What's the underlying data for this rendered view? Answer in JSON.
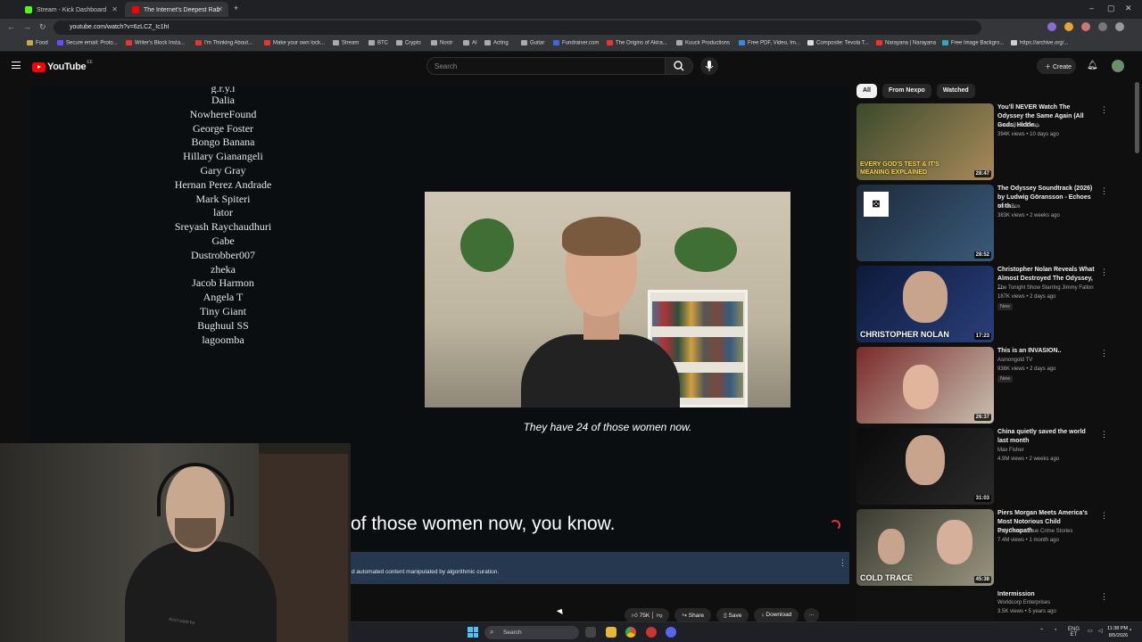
{
  "browser": {
    "tabs": [
      {
        "title": "Stream - Kick Dashboard",
        "color": "#53fc18"
      },
      {
        "title": "The Internet's Deepest Rab",
        "color": "#ff0000"
      }
    ],
    "url": "youtube.com/watch?v=6zLCZ_Ic1hI",
    "bookmarks": [
      "Food",
      "Secure email: Proto...",
      "Writer's Block Insta...",
      "I'm Thinking About...",
      "Make your own lock...",
      "Stream",
      "BTC",
      "Crypto",
      "Nostr",
      "AI",
      "Acting",
      "Guitar",
      "Fundraiser.com",
      "The Origins of Akira...",
      "Kuuck Productions",
      "Free PDF, Video, Im...",
      "Composite: Tevola T...",
      "Narayana | Narayana",
      "Free Image Backgro...",
      "https://archive.org/..."
    ]
  },
  "youtube": {
    "logo_text": "YouTube",
    "logo_cc": "EE",
    "search_placeholder": "Search",
    "create_label": "Create"
  },
  "player": {
    "credits": [
      "g.r.y.l",
      "Dalia",
      "NowhereFound",
      "George Foster",
      "Bongo Banana",
      "Hillary Gianangeli",
      "Gary Gray",
      "Hernan Perez Andrade",
      "Mark Spiteri",
      "lator",
      "Sreyash Raychaudhuri",
      "Gabe",
      "Dustrobber007",
      "zheka",
      "Jacob Harmon",
      "Angela T",
      "Tiny Giant",
      "Bughuul SS",
      "lagoomba"
    ],
    "subtitle_small": "They have 24 of those women now.",
    "caption_big": "of those women now, you know."
  },
  "notice": {
    "text": "d automated content manipulated by algorithmic curation."
  },
  "actions": {
    "likes": "75K",
    "share": "Share",
    "save": "Save",
    "download": "Download"
  },
  "chips": [
    {
      "label": "All",
      "active": true
    },
    {
      "label": "From Nexpo",
      "active": false
    },
    {
      "label": "Watched",
      "active": false
    }
  ],
  "recommendations": [
    {
      "title": "You'll NEVER Watch The Odyssey the Same Again (All Gods, Hidde...",
      "channel": "Movie Balls Deep",
      "meta": "394K views • 10 days ago",
      "duration": "28:47",
      "thumb_text": "EVERY GOD'S TEST & IT'S MEANING EXPLAINED",
      "badge": "",
      "colors": [
        "#3b4a2c",
        "#a98a5a"
      ]
    },
    {
      "title": "The Odyssey Soundtrack (2026) by Ludwig Göransson - Echoes of th...",
      "channel": "Kaka Box",
      "meta": "383K views • 2 weeks ago",
      "duration": "28:52",
      "thumb_text": "",
      "badge": "",
      "colors": [
        "#1d2a3a",
        "#3a5a7a"
      ]
    },
    {
      "title": "Christopher Nolan Reveals What Almost Destroyed The Odyssey, ...",
      "channel": "The Tonight Show Starring Jimmy Fallon",
      "meta": "187K views • 2 days ago",
      "duration": "17:23",
      "thumb_text": "CHRISTOPHER NOLAN",
      "badge": "New",
      "colors": [
        "#0d1a3a",
        "#2a3f7a"
      ]
    },
    {
      "title": "This is an INVASION..",
      "channel": "Asmongold TV",
      "meta": "936K views • 2 days ago",
      "duration": "26:37",
      "thumb_text": "",
      "badge": "New",
      "colors": [
        "#7a2a2a",
        "#c9c0b0"
      ]
    },
    {
      "title": "China quietly saved the world last month",
      "channel": "Max Fisher",
      "meta": "4.9M views • 2 weeks ago",
      "duration": "31:03",
      "thumb_text": "",
      "badge": "",
      "colors": [
        "#0a0a0a",
        "#2a2a2a"
      ]
    },
    {
      "title": "Piers Morgan Meets America's Most Notorious Child Psychopath",
      "channel": "Cold Trace - True Crime Stories",
      "meta": "7.4M views • 1 month ago",
      "duration": "45:38",
      "thumb_text": "COLD TRACE",
      "badge": "",
      "colors": [
        "#3a3a30",
        "#9a9580"
      ]
    },
    {
      "title": "Intermission",
      "channel": "Worldcorp Enterprises",
      "meta": "3.5K views • 5 years ago",
      "duration": "",
      "thumb_text": "",
      "badge": "",
      "colors": [
        "#111",
        "#222"
      ]
    }
  ],
  "webcam": {
    "shirt_text": "don't work for"
  },
  "taskbar": {
    "search_placeholder": "Search",
    "lang": "ENG",
    "region": "ET",
    "time": "11:38 PM",
    "date": "8/5/2026"
  }
}
